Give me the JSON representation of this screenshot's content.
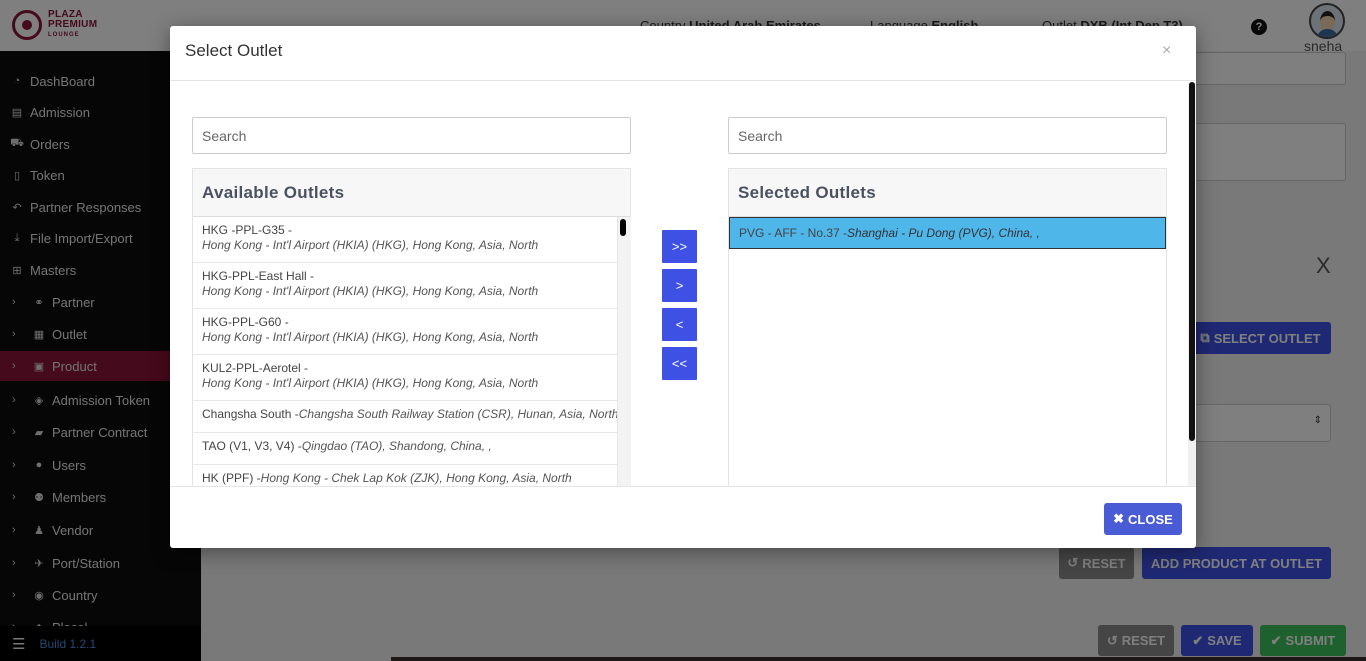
{
  "header": {
    "logo": {
      "line1": "PLAZA",
      "line2": "PREMIUM",
      "line3": "LOUNGE"
    },
    "country_label": "Country",
    "country_value": "United Arab Emirates",
    "language_label": "Language",
    "language_value": "English",
    "outlet_label": "Outlet",
    "outlet_value": "DXB (Int Dep T3)",
    "help_icon": "?",
    "username": "sneha"
  },
  "sidebar": {
    "items": [
      {
        "label": "DashBoard",
        "icon": "tachometer-icon",
        "glyph": "◔"
      },
      {
        "label": "Admission",
        "icon": "id-card-icon",
        "glyph": "▤"
      },
      {
        "label": "Orders",
        "icon": "cart-icon",
        "glyph": "⛟"
      },
      {
        "label": "Token",
        "icon": "file-icon",
        "glyph": "▯"
      },
      {
        "label": "Partner Responses",
        "icon": "reply-icon",
        "glyph": "↶"
      },
      {
        "label": "File Import/Export",
        "icon": "download-icon",
        "glyph": "⤓"
      },
      {
        "label": "Masters",
        "icon": "sitemap-icon",
        "glyph": "⊞"
      },
      {
        "label": "Partner",
        "icon": "handshake-icon",
        "glyph": "⚭"
      },
      {
        "label": "Outlet",
        "icon": "building-icon",
        "glyph": "▦"
      },
      {
        "label": "Product",
        "icon": "gift-icon",
        "glyph": "▣"
      },
      {
        "label": "Admission Token",
        "icon": "tag-icon",
        "glyph": "◈"
      },
      {
        "label": "Partner Contract",
        "icon": "briefcase-icon",
        "glyph": "▰"
      },
      {
        "label": "Users",
        "icon": "user-icon",
        "glyph": "●"
      },
      {
        "label": "Members",
        "icon": "users-icon",
        "glyph": "⚉"
      },
      {
        "label": "Vendor",
        "icon": "male-icon",
        "glyph": "♟"
      },
      {
        "label": "Port/Station",
        "icon": "plane-icon",
        "glyph": "✈"
      },
      {
        "label": "Country",
        "icon": "globe-icon",
        "glyph": "◉"
      },
      {
        "label": "Placel",
        "icon": "map-icon",
        "glyph": "◆"
      }
    ],
    "active_item": "Product",
    "footer_build": "Build 1.2.1"
  },
  "background": {
    "close_x": "X",
    "select_outlet_label": "SELECT OUTLET",
    "reset_label": "RESET",
    "add_product_label": "ADD PRODUCT AT OUTLET",
    "reset2_label": "RESET",
    "save_label": "SAVE",
    "submit_label": "SUBMIT"
  },
  "modal": {
    "title": "Select Outlet",
    "close_icon": "×",
    "available": {
      "search_placeholder": "Search",
      "title": "Available Outlets",
      "items": [
        {
          "code": "HKG -PPL-G35 -",
          "location": "Hong Kong - Int'l Airport (HKIA) (HKG), Hong Kong, Asia, North",
          "two_line": true
        },
        {
          "code": "HKG-PPL-East Hall -",
          "location": "Hong Kong - Int'l Airport (HKIA) (HKG), Hong Kong, Asia, North",
          "two_line": true
        },
        {
          "code": "HKG-PPL-G60 -",
          "location": "Hong Kong - Int'l Airport (HKIA) (HKG), Hong Kong, Asia, North",
          "two_line": true
        },
        {
          "code": "KUL2-PPL-Aerotel -",
          "location": "Hong Kong - Int'l Airport (HKIA) (HKG), Hong Kong, Asia, North",
          "two_line": true
        },
        {
          "code": "Changsha South -",
          "location": "Changsha South Railway Station (CSR), Hunan, Asia, North",
          "two_line": false
        },
        {
          "code": "TAO (V1, V3, V4) -",
          "location": "Qingdao (TAO), Shandong, China, ,",
          "two_line": false
        },
        {
          "code": "HK (PPF) -",
          "location": "Hong Kong - Chek Lap Kok (ZJK), Hong Kong, Asia, North",
          "two_line": false
        }
      ]
    },
    "selected": {
      "search_placeholder": "Search",
      "title": "Selected Outlets",
      "items": [
        {
          "code": "PVG - AFF - No.37 -",
          "location": "Shanghai - Pu Dong (PVG), China, ,"
        }
      ]
    },
    "buttons": {
      "move_all_right": ">>",
      "move_right": ">",
      "move_left": "<",
      "move_all_left": "<<",
      "close": "CLOSE"
    }
  }
}
